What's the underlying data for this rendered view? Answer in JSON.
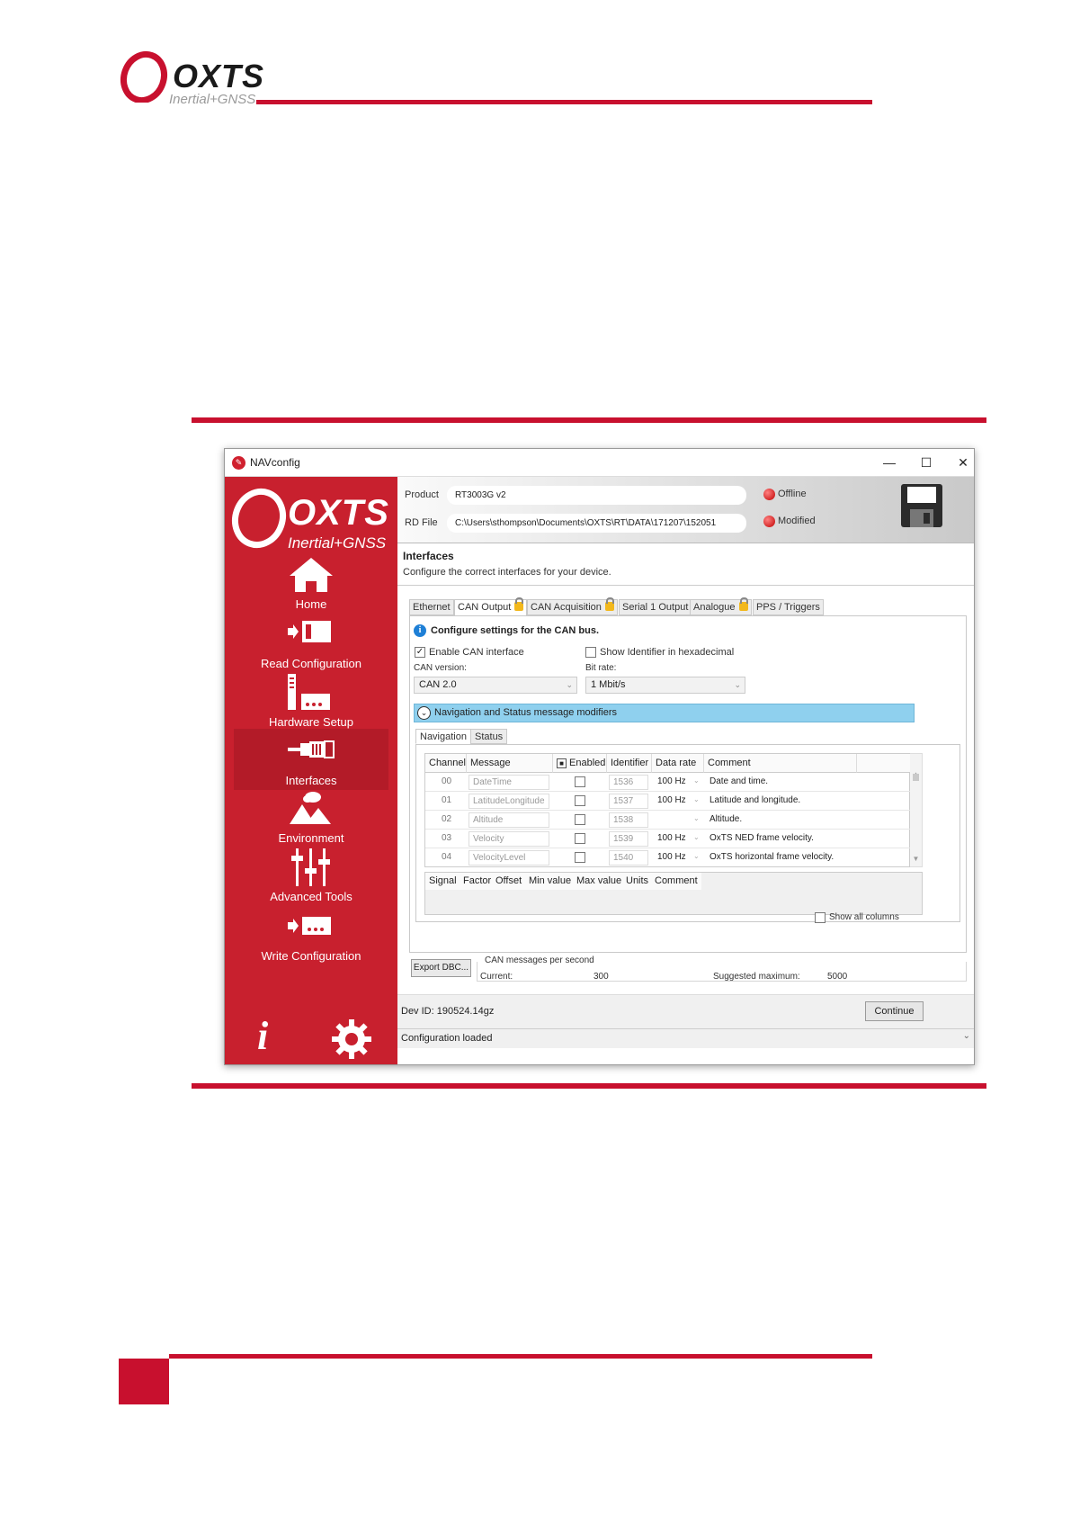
{
  "page": {
    "logo_brand": "OXTS",
    "logo_sub": "Inertial+GNSS"
  },
  "window": {
    "title": "NAVconfig",
    "minimize": "—",
    "maximize": "☐",
    "close": "✕"
  },
  "sidebar": {
    "logo_brand": "OXTS",
    "logo_sub": "Inertial+GNSS",
    "items": [
      {
        "label": "Home",
        "icon": "home-icon"
      },
      {
        "label": "Read Configuration",
        "icon": "read-config-icon"
      },
      {
        "label": "Hardware Setup",
        "icon": "hardware-icon"
      },
      {
        "label": "Interfaces",
        "icon": "interfaces-icon"
      },
      {
        "label": "Environment",
        "icon": "environment-icon"
      },
      {
        "label": "Advanced Tools",
        "icon": "sliders-icon"
      },
      {
        "label": "Write Configuration",
        "icon": "write-config-icon"
      }
    ],
    "info_glyph": "i"
  },
  "header": {
    "product_label": "Product",
    "product_value": "RT3003G v2",
    "rdfile_label": "RD File",
    "rdfile_value": "C:\\Users\\sthompson\\Documents\\OXTS\\RT\\DATA\\171207\\152051",
    "status_offline": "Offline",
    "status_modified": "Modified",
    "led_color": "#d40000"
  },
  "section": {
    "title": "Interfaces",
    "subtitle": "Configure the correct interfaces for your device."
  },
  "tabs": [
    "Ethernet",
    "CAN Output",
    "CAN Acquisition",
    "Serial 1 Output",
    "Analogue",
    "PPS / Triggers"
  ],
  "can": {
    "info": "Configure settings for the CAN bus.",
    "enable_label": "Enable CAN interface",
    "enable_checked": "✓",
    "hex_label": "Show Identifier in hexadecimal",
    "version_label": "CAN version:",
    "version_value": "CAN 2.0",
    "bitrate_label": "Bit rate:",
    "bitrate_value": "1 Mbit/s",
    "modifiers_label": "Navigation and Status message modifiers",
    "subtabs": [
      "Navigation",
      "Status"
    ]
  },
  "table": {
    "headers": [
      "Channel",
      "Message",
      "Enabled",
      "Identifier",
      "Data rate",
      "Comment"
    ],
    "header_enabled_mark": "■",
    "rows": [
      {
        "channel": "00",
        "message": "DateTime",
        "id": "1536",
        "rate": "100 Hz",
        "comment": "Date and time."
      },
      {
        "channel": "01",
        "message": "LatitudeLongitude",
        "id": "1537",
        "rate": "100 Hz",
        "comment": "Latitude and longitude."
      },
      {
        "channel": "02",
        "message": "Altitude",
        "id": "1538",
        "rate": "",
        "comment": "Altitude."
      },
      {
        "channel": "03",
        "message": "Velocity",
        "id": "1539",
        "rate": "100 Hz",
        "comment": "OxTS NED frame velocity."
      },
      {
        "channel": "04",
        "message": "VelocityLevel",
        "id": "1540",
        "rate": "100 Hz",
        "comment": "OxTS horizontal frame velocity."
      }
    ]
  },
  "signals": {
    "headers": [
      "Signal",
      "Factor",
      "Offset",
      "Min value",
      "Max value",
      "Units",
      "Comment"
    ]
  },
  "show_all_label": "Show all columns",
  "export_label": "Export DBC...",
  "can_stats": {
    "legend": "CAN messages per second",
    "current_label": "Current:",
    "current_value": "300",
    "max_label": "Suggested maximum:",
    "max_value": "5000"
  },
  "footer": {
    "dev_id": "Dev ID: 190524.14gz",
    "continue_label": "Continue",
    "status_text": "Configuration loaded"
  },
  "colors": {
    "brand_red": "#c8202e",
    "accent_blue": "#8fd0ee"
  }
}
